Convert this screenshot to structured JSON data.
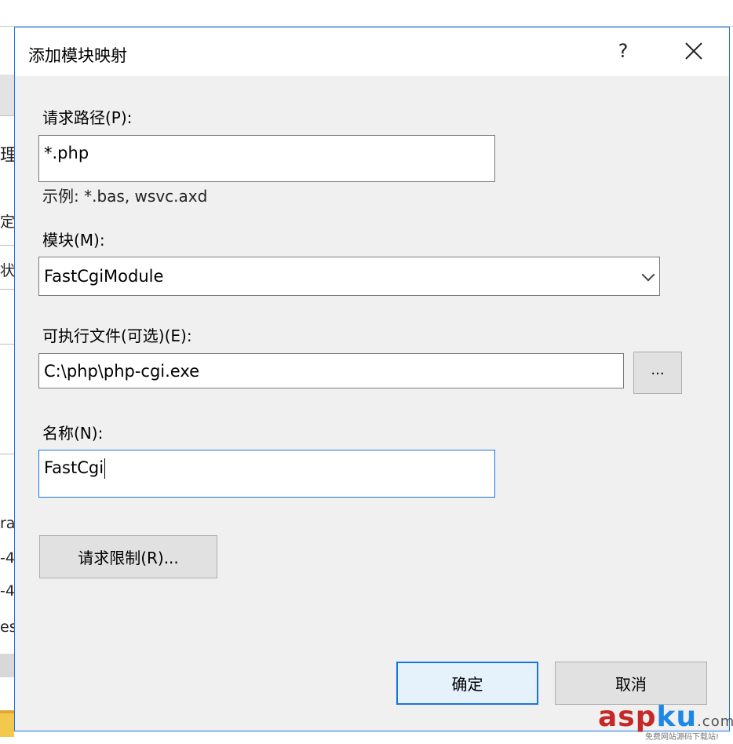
{
  "background": {
    "fragments": [
      "理",
      "定",
      "状",
      "ra",
      "-4",
      "-4",
      "es"
    ]
  },
  "dialog": {
    "title": "添加模块映射",
    "help_label": "?",
    "close_label": "✕",
    "request_path": {
      "label": "请求路径(P):",
      "value": "*.php",
      "hint": "示例: *.bas, wsvc.axd"
    },
    "module": {
      "label": "模块(M):",
      "selected": "FastCgiModule"
    },
    "executable": {
      "label": "可执行文件(可选)(E):",
      "value": "C:\\php\\php-cgi.exe",
      "browse_label": "..."
    },
    "name": {
      "label": "名称(N):",
      "value": "FastCgi"
    },
    "request_limits_label": "请求限制(R)...",
    "ok_label": "确定",
    "cancel_label": "取消"
  },
  "watermark": {
    "asp": "asp",
    "ku": "ku",
    "com": ".com",
    "subtitle": "免费网站源码下载站!"
  },
  "colors": {
    "accent": "#1a73e8",
    "dialog_bg": "#f0f0f0",
    "button_bg": "#e1e1e1"
  }
}
